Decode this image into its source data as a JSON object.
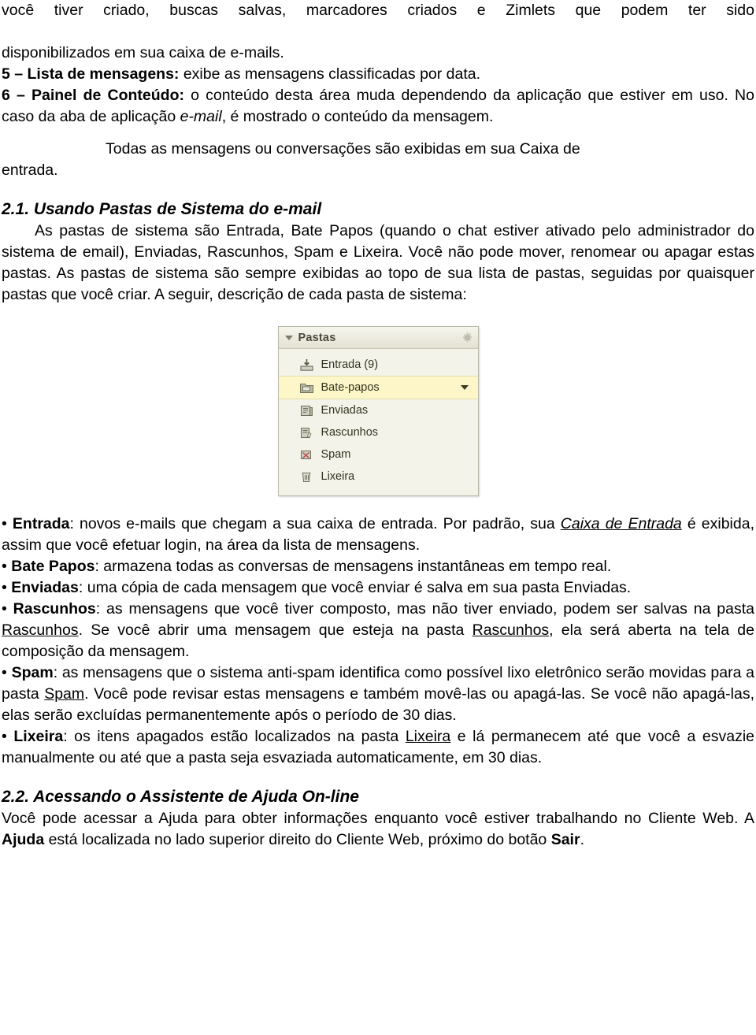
{
  "document": {
    "intro_paragraphs": [
      "você tiver criado, buscas salvas, marcadores criados e Zimlets que podem ter sido disponibilizados em sua caixa de e-mails.",
      "5 – Lista de mensagens: exibe as mensagens classificadas por data.",
      "6 – Painel de Conteúdo: o conteúdo desta área muda dependendo da aplicação que estiver em uso. No caso da aba de aplicação e-mail, é mostrado o conteúdo da mensagem.",
      "Todas as mensagens ou conversações são exibidas em sua Caixa de entrada."
    ],
    "line1_a": "você tiver criado, buscas salvas, marcadores criados e Zimlets que podem ter sido",
    "line1_b": "disponibilizados em sua caixa de e-mails.",
    "item5_label": "5 – Lista de mensagens:",
    "item5_text": " exibe as mensagens classificadas por data.",
    "item6_label": "6 – Painel de Conteúdo:",
    "item6_text_a": " o conteúdo desta área muda dependendo da aplicação que estiver em uso. No caso da aba de aplicação ",
    "item6_italic": "e-mail",
    "item6_text_b": ", é mostrado o conteúdo da mensagem.",
    "caixa_entrada_a": "Todas as mensagens ou conversações são exibidas em sua Caixa de",
    "caixa_entrada_b": "entrada.",
    "section_2_1": "2.1. Usando Pastas de Sistema do e-mail",
    "section_2_1_body": "As pastas de sistema são Entrada, Bate Papos (quando o chat estiver ativado pelo administrador do sistema de email), Enviadas, Rascunhos, Spam e Lixeira. Você não pode mover, renomear ou apagar estas pastas. As pastas de sistema são sempre exibidas ao topo de sua lista de pastas, seguidas por quaisquer pastas que você criar. A seguir, descrição de cada pasta de sistema:",
    "bullets": [
      {
        "bullet": "•",
        "label": "Entrada",
        "text_a": ": novos e-mails que chegam a sua caixa de entrada. Por padrão, sua ",
        "underline_italic": "Caixa de Entrada",
        "text_b": " é exibida, assim que você efetuar login, na área da lista de mensagens."
      },
      {
        "bullet": "•",
        "label": "Bate Papos",
        "text_a": ": armazena todas as conversas de mensagens instantâneas em tempo real.",
        "underline_italic": "",
        "text_b": ""
      },
      {
        "bullet": "•",
        "label": "Enviadas",
        "text_a": ": uma cópia de cada mensagem que você enviar é salva em sua pasta Enviadas.",
        "underline_italic": "",
        "text_b": ""
      }
    ],
    "bullet_rascunhos": {
      "bullet": "•",
      "label": "Rascunhos",
      "t1": ": as mensagens que você tiver composto, mas não tiver enviado, podem ser salvas na pasta ",
      "u1": "Rascunhos",
      "t2": ". Se você abrir uma mensagem que esteja na pasta ",
      "u2": "Rascunhos",
      "t3": ", ela será aberta na tela de composição da mensagem."
    },
    "bullet_spam": {
      "bullet": "•",
      "label": "Spam",
      "t1": ": as mensagens que o sistema anti-spam identifica como possível lixo eletrônico serão movidas para a pasta ",
      "u1": "Spam",
      "t2": ". Você pode revisar estas mensagens e também movê-las ou apagá-las. Se você não apagá-las, elas serão excluídas permanentemente após o período de 30 dias."
    },
    "bullet_lixeira": {
      "bullet": "•",
      "label": "Lixeira",
      "t1": ": os itens apagados estão localizados na pasta ",
      "u1": "Lixeira",
      "t2": " e lá permanecem até que você a esvazie manualmente ou até que a pasta seja esvaziada automaticamente, em 30 dias."
    },
    "section_2_2": "2.2. Acessando o Assistente de Ajuda On-line",
    "section_2_2_body_a": "Você pode acessar a Ajuda para obter informações enquanto você estiver trabalhando no Cliente Web. A ",
    "section_2_2_bold": "Ajuda",
    "section_2_2_body_b": " está localizada no lado superior direito do Cliente Web, próximo do botão ",
    "section_2_2_bold2": "Sair",
    "section_2_2_body_c": "."
  },
  "folder_panel": {
    "header_title": "Pastas",
    "header_icon": "collapse-triangle-icon",
    "gear_icon": "gear-icon",
    "selected_folder": "Bate-papos",
    "items": [
      {
        "label": "Entrada (9)",
        "icon": "inbox-icon",
        "selected": false,
        "has_caret": false
      },
      {
        "label": "Bate-papos",
        "icon": "chat-folder-icon",
        "selected": true,
        "has_caret": true
      },
      {
        "label": "Enviadas",
        "icon": "sent-folder-icon",
        "selected": false,
        "has_caret": false
      },
      {
        "label": "Rascunhos",
        "icon": "drafts-folder-icon",
        "selected": false,
        "has_caret": false
      },
      {
        "label": "Spam",
        "icon": "spam-folder-icon",
        "selected": false,
        "has_caret": false
      },
      {
        "label": "Lixeira",
        "icon": "trash-folder-icon",
        "selected": false,
        "has_caret": false
      }
    ],
    "colors": {
      "panel_bg": "#f4f3ea",
      "header_bg": "#efeee3",
      "selected_bg": "#fdf6c8",
      "border": "#b9b9a8"
    }
  }
}
